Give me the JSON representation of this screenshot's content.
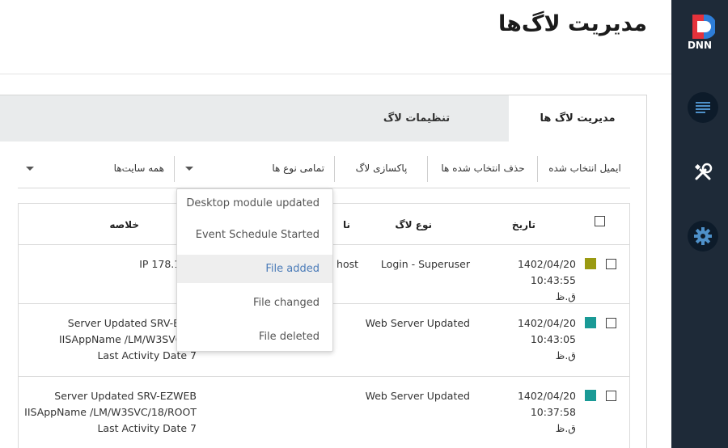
{
  "header": {
    "title": "مدیریت لاگ‌ها"
  },
  "logo": {
    "text": "DNN"
  },
  "sidebar": {
    "items": [
      {
        "icon": "content-icon"
      },
      {
        "icon": "tools-icon"
      },
      {
        "icon": "gear-icon"
      }
    ]
  },
  "tabs": [
    {
      "label": "مدیریت لاگ ها",
      "active": true
    },
    {
      "label": "تنظیمات لاگ",
      "active": false
    }
  ],
  "toolbar": {
    "email_selected": "ایمیل انتخاب شده",
    "delete_selected": "حذف انتخاب شده ها",
    "clear_log": "پاکسازی لاگ",
    "type_filter": "تمامی نوع ها",
    "site_filter": "همه سایت‌ها"
  },
  "table": {
    "headers": {
      "date": "تاریخ",
      "log_type": "نوع لاگ",
      "name_partial": "نا",
      "summary": "خلاصه"
    },
    "rows": [
      {
        "color": "#9a9a12",
        "date": "1402/04/20 10:43:55",
        "date_suffix": "ق.ظ",
        "log_type": "Login - Superuser",
        "name": "host",
        "summary": [
          "IP 178.131.77"
        ]
      },
      {
        "color": "#1a9a96",
        "date": "1402/04/20 10:43:05",
        "date_suffix": "ق.ظ",
        "log_type": "Web Server Updated",
        "name": "",
        "summary": [
          "Server Updated SRV-EZW",
          "IISAppName /LM/W3SVC/18/R",
          "Last Activity Date 7"
        ]
      },
      {
        "color": "#1a9a96",
        "date": "1402/04/20 10:37:58",
        "date_suffix": "ق.ظ",
        "log_type": "Web Server Updated",
        "name": "",
        "summary": [
          "Server Updated SRV-EZWEB",
          "IISAppName /LM/W3SVC/18/ROOT",
          "Last Activity Date 7"
        ]
      }
    ]
  },
  "dropdown": {
    "items": [
      {
        "label": "Desktop module updated",
        "selected": false
      },
      {
        "label": "Event Schedule Started",
        "selected": false
      },
      {
        "label": "File added",
        "selected": true
      },
      {
        "label": "File changed",
        "selected": false
      },
      {
        "label": "File deleted",
        "selected": false
      }
    ]
  },
  "colors": {
    "sidebar_bg": "#1e2a38",
    "logo_red": "#e5323b",
    "logo_blue": "#2e7dd7",
    "link_blue": "#4a7bb8"
  }
}
